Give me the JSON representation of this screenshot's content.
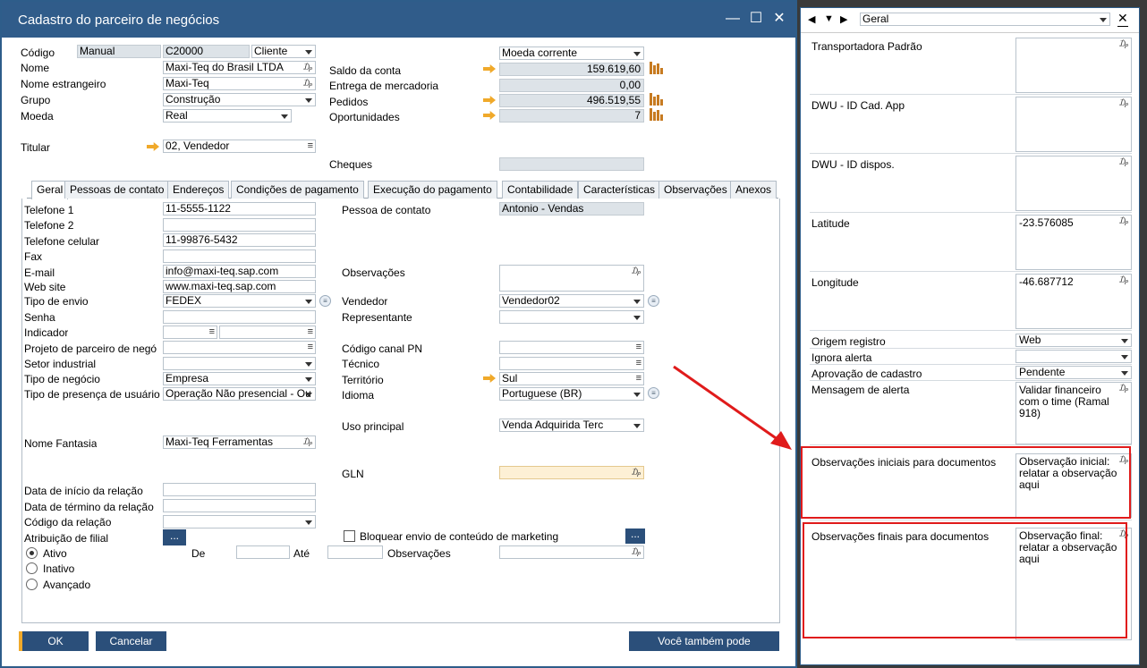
{
  "window": {
    "title": "Cadastro do parceiro de negócios",
    "min": "—",
    "max": "☐",
    "close": "✕"
  },
  "header": {
    "codigo_label": "Código",
    "codigo_series": "Manual",
    "codigo_value": "C20000",
    "codigo_type": "Cliente",
    "nome_label": "Nome",
    "nome_value": "Maxi-Teq do Brasil LTDA",
    "nome_estr_label": "Nome estrangeiro",
    "nome_estr_value": "Maxi-Teq",
    "grupo_label": "Grupo",
    "grupo_value": "Construção",
    "moeda_label": "Moeda",
    "moeda_value": "Real",
    "titular_label": "Titular",
    "titular_value": "02, Vendedor",
    "moeda_corrente": "Moeda corrente",
    "saldo_label": "Saldo da conta",
    "saldo_value": "159.619,60",
    "entrega_label": "Entrega de mercadoria",
    "entrega_value": "0,00",
    "pedidos_label": "Pedidos",
    "pedidos_value": "496.519,55",
    "oport_label": "Oportunidades",
    "oport_value": "7",
    "cheques_label": "Cheques"
  },
  "tabs": [
    "Geral",
    "Pessoas de contato",
    "Endereços",
    "Condições de pagamento",
    "Execução do pagamento",
    "Contabilidade",
    "Características",
    "Observações",
    "Anexos"
  ],
  "general": {
    "tel1_label": "Telefone 1",
    "tel1": "11-5555-1122",
    "tel2_label": "Telefone 2",
    "cel_label": "Telefone celular",
    "cel": "11-99876-5432",
    "fax_label": "Fax",
    "email_label": "E-mail",
    "email": "info@maxi-teq.sap.com",
    "web_label": "Web site",
    "web": "www.maxi-teq.sap.com",
    "envio_label": "Tipo de envio",
    "envio": "FEDEX",
    "senha_label": "Senha",
    "indicador_label": "Indicador",
    "projeto_label": "Projeto de parceiro de negó",
    "setor_label": "Setor industrial",
    "negocio_label": "Tipo de negócio",
    "negocio": "Empresa",
    "presenca_label": "Tipo de presença de usuário",
    "presenca": "Operação Não presencial - Ou",
    "fantasia_label": "Nome Fantasia",
    "fantasia": "Maxi-Teq Ferramentas",
    "inicio_label": "Data de início da relação",
    "termino_label": "Data de término da relação",
    "codrel_label": "Código da relação",
    "filial_label": "Atribuição de filial",
    "contato_label": "Pessoa de contato",
    "contato": "Antonio - Vendas",
    "obs_label": "Observações",
    "vendedor_label": "Vendedor",
    "vendedor": "Vendedor02",
    "repr_label": "Representante",
    "canal_label": "Código canal PN",
    "tecnico_label": "Técnico",
    "territorio_label": "Território",
    "territorio": "Sul",
    "idioma_label": "Idioma",
    "idioma": "Portuguese (BR)",
    "uso_label": "Uso principal",
    "uso": "Venda Adquirida Terc",
    "gln_label": "GLN",
    "bloquear_label": "Bloquear envio de conteúdo de marketing",
    "ativo": "Ativo",
    "inativo": "Inativo",
    "avancado": "Avançado",
    "de": "De",
    "ate": "Até",
    "obs2": "Observações",
    "dots": "..."
  },
  "buttons": {
    "ok": "OK",
    "cancel": "Cancelar",
    "also": "Você também pode"
  },
  "side": {
    "combo": "Geral",
    "rows": [
      {
        "label": "Transportadora Padrão",
        "value": ""
      },
      {
        "label": "DWU - ID Cad. App",
        "value": ""
      },
      {
        "label": "DWU - ID dispos.",
        "value": ""
      },
      {
        "label": "Latitude",
        "value": "-23.576085"
      },
      {
        "label": "Longitude",
        "value": "-46.687712"
      }
    ],
    "origem_label": "Origem registro",
    "origem": "Web",
    "ignora_label": "Ignora alerta",
    "ignora": "",
    "aprov_label": "Aprovação de cadastro",
    "aprov": "Pendente",
    "msg_label": "Mensagem de alerta",
    "msg": "Validar financeiro com o time (Ramal 918)",
    "obs_ini_label": "Observações iniciais para documentos",
    "obs_ini": "Observação inicial: relatar a observação aqui",
    "obs_fin_label": "Observações finais para documentos",
    "obs_fin": "Observação final: relatar a observação aqui"
  },
  "colors": {
    "titlebar": "#305c8a",
    "button": "#2b4f7a",
    "highlight": "#e01b1b",
    "arrow": "#f0a92a"
  }
}
